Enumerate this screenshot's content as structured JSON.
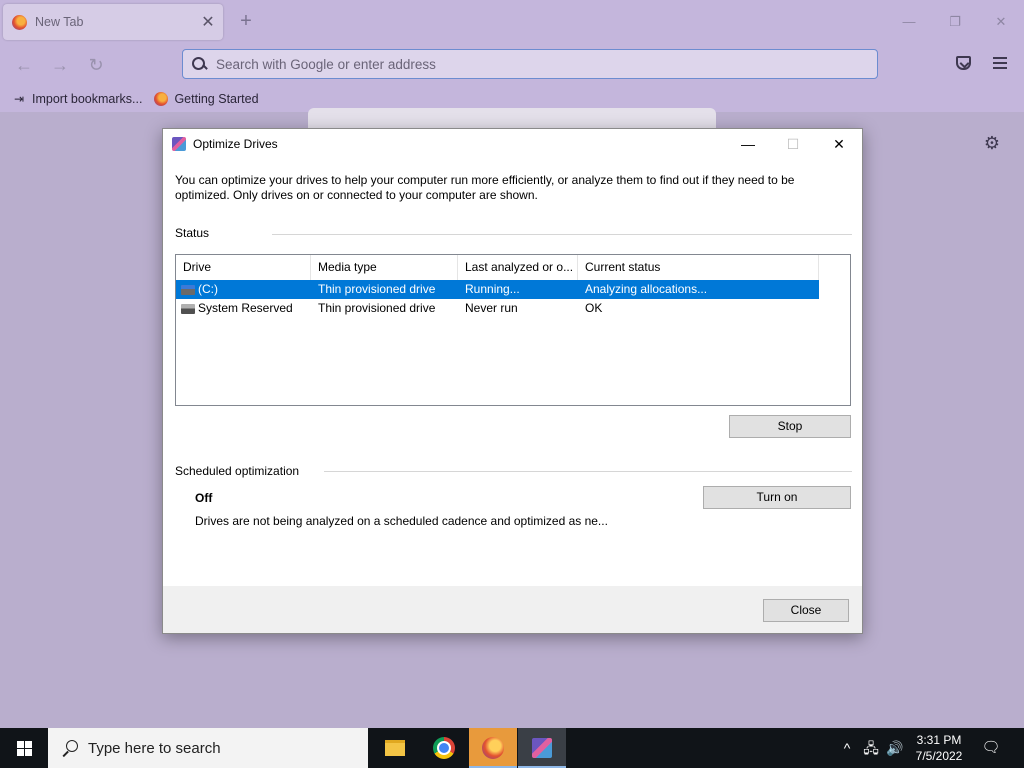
{
  "browser": {
    "tab": {
      "title": "New Tab",
      "close_glyph": "✕"
    },
    "newtab_glyph": "+",
    "window_controls": {
      "minimize": "—",
      "restore": "❐",
      "close": "✕"
    },
    "nav": {
      "back": "←",
      "forward": "→",
      "reload": "↻"
    },
    "urlbar": {
      "placeholder": "Search with Google or enter address"
    },
    "bookmarks": [
      {
        "label": "Import bookmarks...",
        "icon": "import-icon"
      },
      {
        "label": "Getting Started",
        "icon": "firefox-icon"
      }
    ],
    "settings_glyph": "⚙"
  },
  "dialog": {
    "title": "Optimize Drives",
    "controls": {
      "minimize": "—",
      "maximize": "☐",
      "close": "✕"
    },
    "intro": "You can optimize your drives to help your computer run more efficiently, or analyze them to find out if they need to be optimized. Only drives on or connected to your computer are shown.",
    "status_label": "Status",
    "columns": [
      "Drive",
      "Media type",
      "Last analyzed or o...",
      "Current status"
    ],
    "drives": [
      {
        "drive": "(C:)",
        "media": "Thin provisioned drive",
        "last": "Running...",
        "status": "Analyzing allocations...",
        "selected": true,
        "icon": "system-drive-icon"
      },
      {
        "drive": "System Reserved",
        "media": "Thin provisioned drive",
        "last": "Never run",
        "status": "OK",
        "selected": false,
        "icon": "drive-icon"
      }
    ],
    "stop_button": "Stop",
    "scheduled_label": "Scheduled optimization",
    "schedule_state": "Off",
    "schedule_desc": "Drives are not being analyzed on a scheduled cadence and optimized as ne...",
    "turn_on_button": "Turn on",
    "close_button": "Close"
  },
  "taskbar": {
    "search_placeholder": "Type here to search",
    "apps": [
      "file-explorer",
      "chrome",
      "firefox",
      "optimize-drives"
    ],
    "tray": {
      "chevron": "^",
      "network": "🖧",
      "volume": "🔊",
      "notifications": "🗨"
    },
    "time": "3:31 PM",
    "date": "7/5/2022"
  },
  "colors": {
    "selection": "#0078d7",
    "browser_bg": "#c4b6dc",
    "page_bg": "#b9aecd",
    "taskbar": "#101418"
  }
}
